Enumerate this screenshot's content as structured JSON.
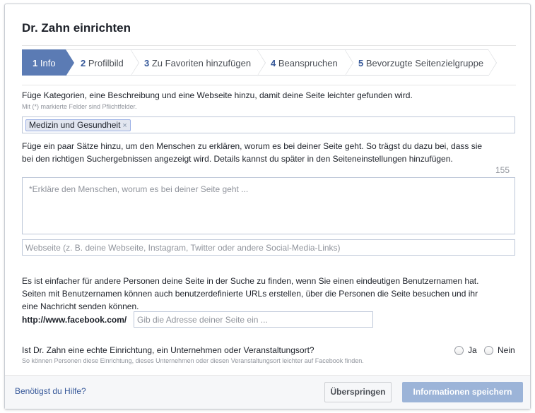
{
  "dialog": {
    "title": "Dr. Zahn einrichten"
  },
  "steps": [
    {
      "num": "1",
      "label": "Info"
    },
    {
      "num": "2",
      "label": "Profilbild"
    },
    {
      "num": "3",
      "label": "Zu Favoriten hinzufügen"
    },
    {
      "num": "4",
      "label": "Beanspruchen"
    },
    {
      "num": "5",
      "label": "Bevorzugte Seitenzielgruppe"
    }
  ],
  "categories": {
    "intro": "Füge Kategorien, eine Beschreibung und eine Webseite hinzu, damit deine Seite leichter gefunden wird.",
    "required_note": "Mit (*) markierte Felder sind Pflichtfelder.",
    "selected_tag": "Medizin und Gesundheit",
    "remove_symbol": "×"
  },
  "description": {
    "line1": "Füge ein paar Sätze hinzu, um den Menschen zu erklären, worum es bei deiner Seite geht. So trägst du dazu bei, dass sie",
    "line2": "bei den richtigen Suchergebnissen angezeigt wird. Details kannst du später in den Seiteneinstellungen hinzufügen.",
    "char_counter": "155",
    "placeholder": "*Erkläre den Menschen, worum es bei deiner Seite geht ..."
  },
  "website": {
    "placeholder": "Webseite (z. B. deine Webseite, Instagram, Twitter oder andere Social-Media-Links)"
  },
  "username": {
    "line1": "Es ist einfacher für andere Personen deine Seite in der Suche zu finden, wenn Sie einen eindeutigen Benutzernamen hat.",
    "line2": "Seiten mit Benutzernamen können auch benutzerdefinierte URLs erstellen, über die Personen die Seite besuchen und ihr",
    "line3": "eine Nachricht senden können.",
    "prefix": "http://www.facebook.com/",
    "placeholder": "Gib die Adresse deiner Seite ein ..."
  },
  "location_question": {
    "question": "Ist Dr. Zahn eine echte Einrichtung, ein Unternehmen oder Veranstaltungsort?",
    "hint": "So können Personen diese Einrichtung, dieses Unternehmen oder diesen Veranstaltungsort leichter auf Facebook finden.",
    "yes_label": "Ja",
    "no_label": "Nein"
  },
  "footer": {
    "help_link": "Benötigst du Hilfe?",
    "skip_label": "Überspringen",
    "save_label": "Informationen speichern"
  },
  "colors": {
    "active_step": "#5b7bb4",
    "link": "#365899",
    "save_button": "#9cb4d8"
  }
}
